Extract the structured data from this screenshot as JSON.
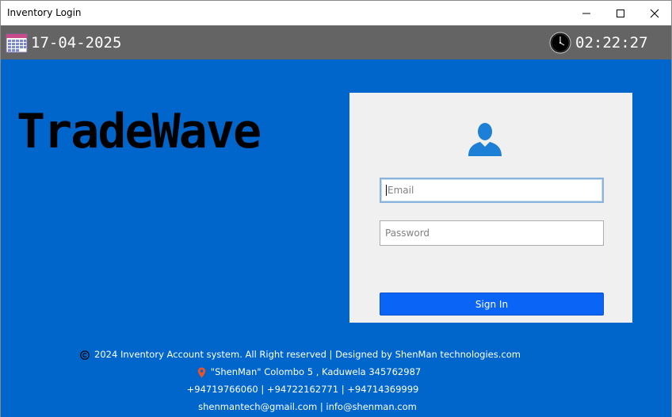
{
  "window": {
    "title": "Inventory Login",
    "controls": [
      "minimize",
      "maximize",
      "close"
    ]
  },
  "topbar": {
    "date": "17-04-2025",
    "time": "02:22:27",
    "icons": [
      "calendar-icon",
      "clock-icon"
    ]
  },
  "brand": {
    "name": "TradeWave"
  },
  "login": {
    "email_placeholder": "Email",
    "email_value": "",
    "password_placeholder": "Password",
    "password_value": "",
    "signin_label": "Sign In",
    "icon": "user-icon"
  },
  "footer": {
    "copyright": "2024 Inventory Account system. All Right reserved | Designed by ShenMan technologies.com",
    "address": "\"ShenMan\" Colombo 5 , Kaduwela 345762987",
    "phones": "+94719766060 | +94722162771 | +94714369999",
    "emails": "shenmantech@gmail.com | info@shenman.com"
  },
  "colors": {
    "main_bg": "#0066cc",
    "topbar_bg": "#646464",
    "card_bg": "#f0f0f0",
    "button_bg": "#0a64f5",
    "location_pin": "#e8532c"
  }
}
